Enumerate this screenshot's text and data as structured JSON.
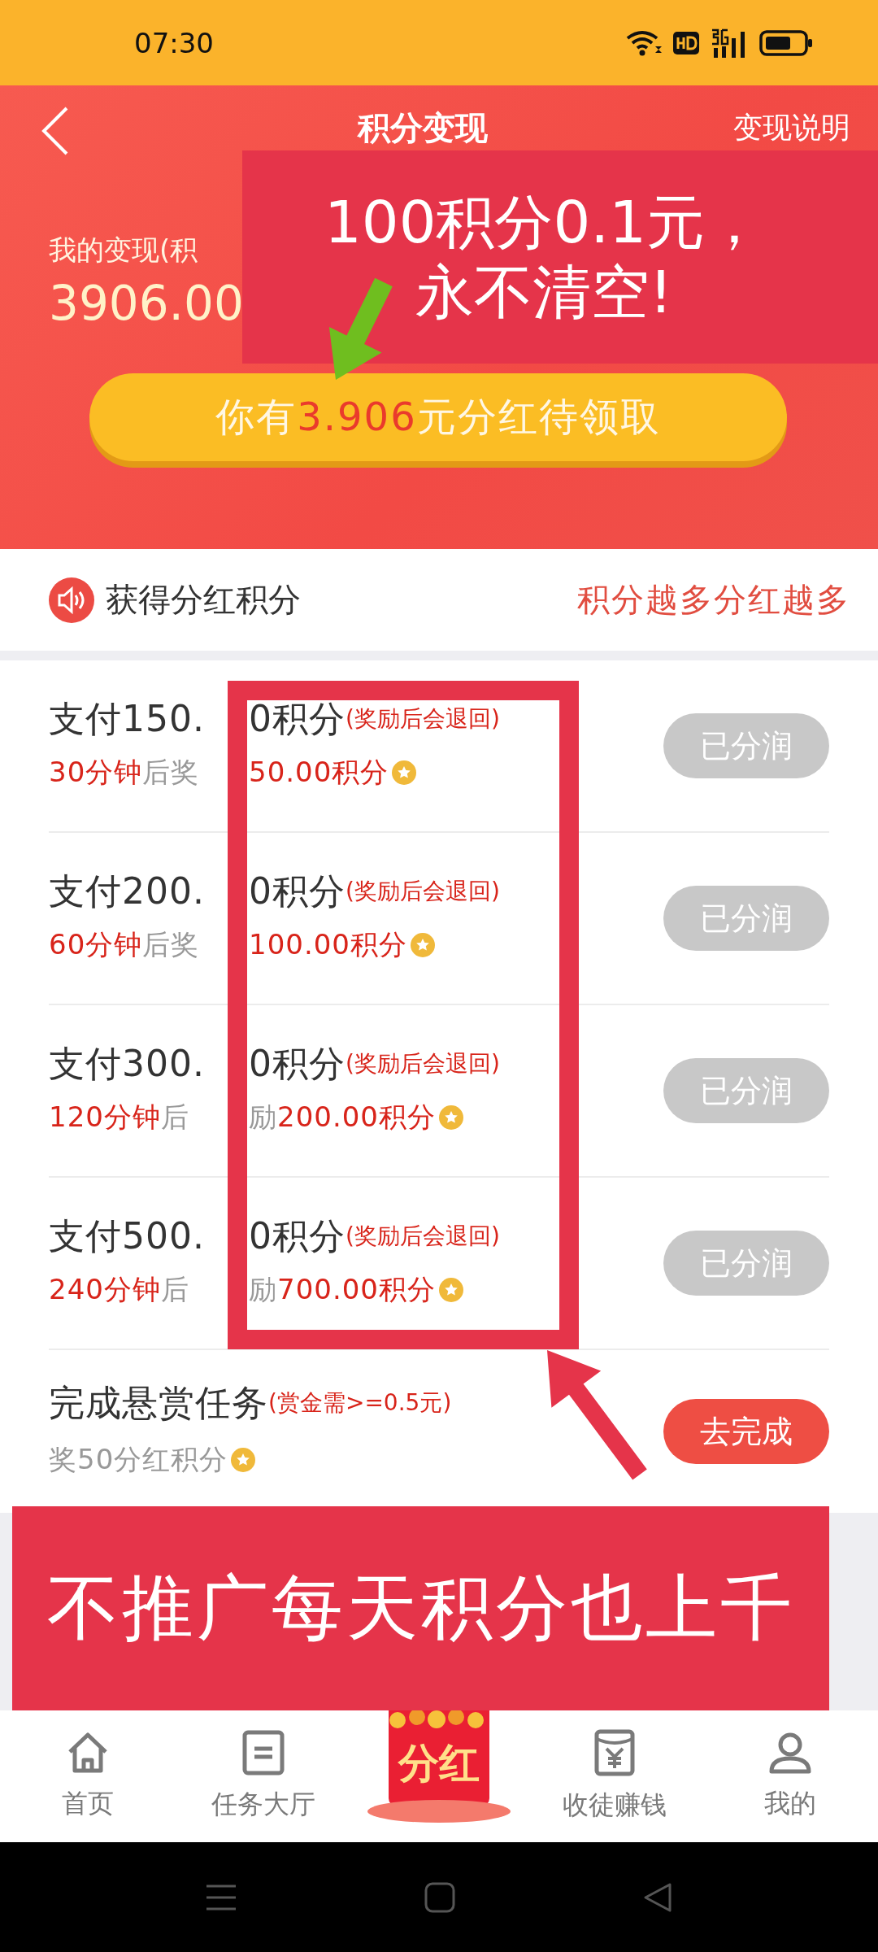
{
  "status_bar": {
    "time": "07:30"
  },
  "header": {
    "title": "积分变现",
    "action": "变现说明",
    "balance_label": "我的变现(积",
    "balance": "3906.00"
  },
  "claim_button": {
    "prefix": "你有",
    "amount": "3.906",
    "suffix": "元分红待领取"
  },
  "section": {
    "title": "获得分红积分",
    "slogan": "积分越多分红越多"
  },
  "tasks": [
    {
      "kind": "pay",
      "title_left": "支付150.",
      "title_right": "0积分",
      "note": "(奖励后会退回)",
      "reward_left": [
        {
          "text": "30分钟",
          "highlight": true
        },
        {
          "text": "后奖",
          "highlight": false
        }
      ],
      "reward_right": [
        {
          "text": "50.00积分",
          "highlight": true
        }
      ],
      "button": "已分润",
      "done": true
    },
    {
      "kind": "pay",
      "title_left": "支付200.",
      "title_right": "0积分",
      "note": "(奖励后会退回)",
      "reward_left": [
        {
          "text": "60分钟",
          "highlight": true
        },
        {
          "text": "后奖",
          "highlight": false
        }
      ],
      "reward_right": [
        {
          "text": "100.00积分",
          "highlight": true
        }
      ],
      "button": "已分润",
      "done": true
    },
    {
      "kind": "pay",
      "title_left": "支付300.",
      "title_right": "0积分",
      "note": "(奖励后会退回)",
      "reward_left": [
        {
          "text": "120分钟",
          "highlight": true
        },
        {
          "text": "后",
          "highlight": false
        }
      ],
      "reward_right": [
        {
          "text": "励",
          "highlight": false
        },
        {
          "text": "200.00积分",
          "highlight": true
        }
      ],
      "button": "已分润",
      "done": true
    },
    {
      "kind": "pay",
      "title_left": "支付500.",
      "title_right": "0积分",
      "note": "(奖励后会退回)",
      "reward_left": [
        {
          "text": "240分钟",
          "highlight": true
        },
        {
          "text": "后",
          "highlight": false
        }
      ],
      "reward_right": [
        {
          "text": "励",
          "highlight": false
        },
        {
          "text": "700.00积分",
          "highlight": true
        }
      ],
      "button": "已分润",
      "done": true
    },
    {
      "kind": "bounty",
      "title": "完成悬赏任务",
      "note": "(赏金需>=0.5元)",
      "reward": "奖50分红积分",
      "button": "去完成",
      "done": false
    }
  ],
  "annotations": {
    "top_note": [
      "100积分0.1元，",
      "永不清空!"
    ],
    "bottom_note": "不推广每天积分也上千"
  },
  "bottom_nav": [
    {
      "kind": "home",
      "label": "首页"
    },
    {
      "kind": "tasks",
      "label": "任务大厅"
    },
    {
      "kind": "packet",
      "label": "分红"
    },
    {
      "kind": "money",
      "label": "收徒赚钱"
    },
    {
      "kind": "profile",
      "label": "我的"
    }
  ]
}
